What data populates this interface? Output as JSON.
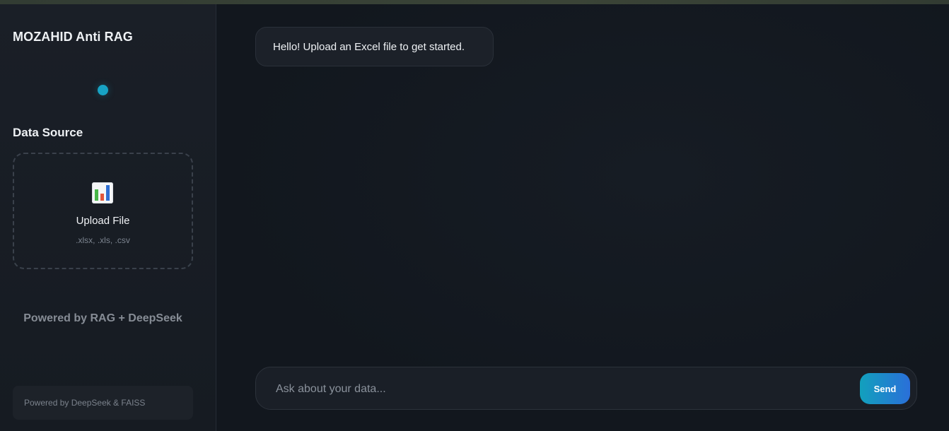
{
  "sidebar": {
    "app_title": "MOZAHID Anti RAG",
    "status_color": "#17a3c4",
    "section_title": "Data Source",
    "upload": {
      "icon": "bar-chart-icon",
      "label": "Upload File",
      "hint": ".xlsx, .xls, .csv"
    },
    "powered_rag": "Powered by RAG + DeepSeek",
    "footer": "Powered by DeepSeek & FAISS"
  },
  "chat": {
    "messages": [
      {
        "role": "assistant",
        "text": "Hello! Upload an Excel file to get started."
      }
    ],
    "input": {
      "placeholder": "Ask about your data...",
      "value": ""
    },
    "send_label": "Send",
    "accent_gradient": [
      "#12a0bd",
      "#2a6fd9"
    ]
  }
}
